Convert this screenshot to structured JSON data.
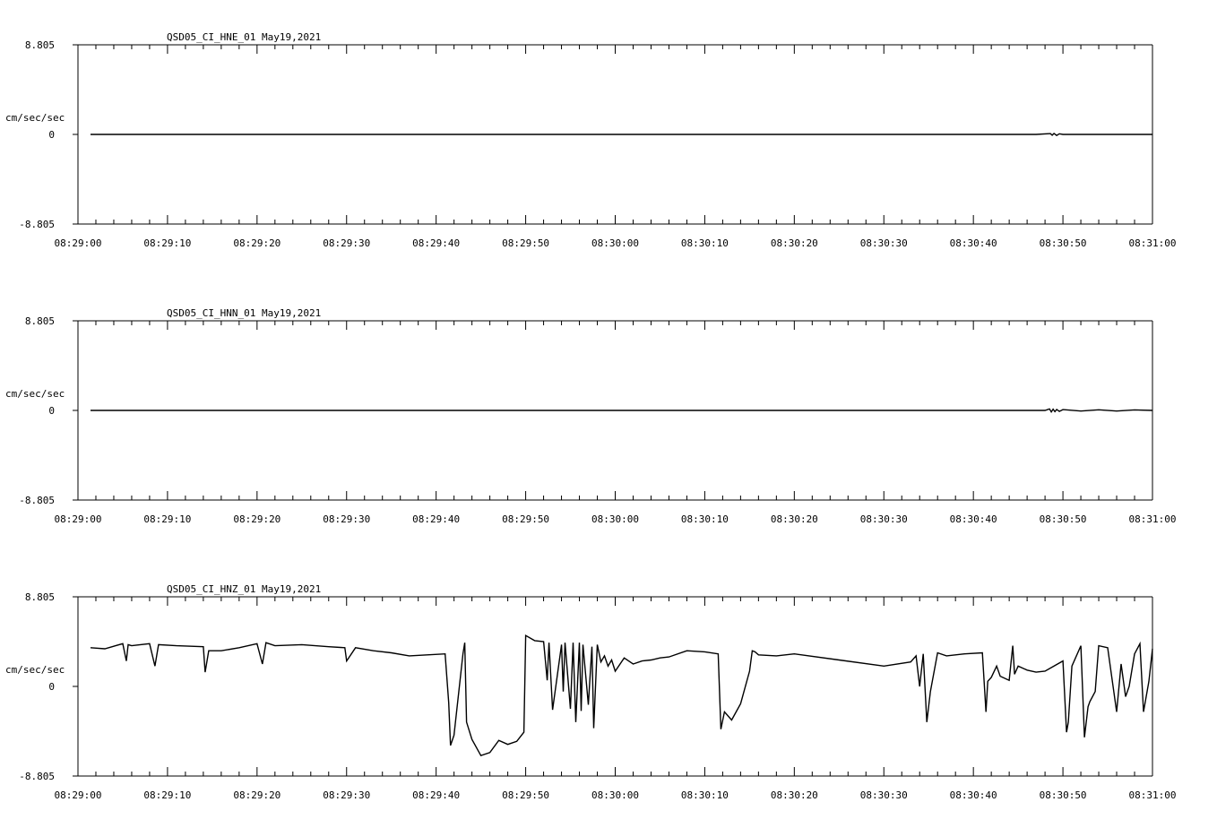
{
  "chart_data": [
    {
      "type": "line",
      "title": "QSD05_CI_HNE_01  May19,2021",
      "ylabel": "cm/sec/sec",
      "ylim": [
        -8.805,
        8.805
      ],
      "ytick_labels": [
        "8.805",
        "0",
        "-8.805"
      ],
      "x_ticks": [
        "08:29:00",
        "08:29:10",
        "08:29:20",
        "08:29:30",
        "08:29:40",
        "08:29:50",
        "08:30:00",
        "08:30:10",
        "08:30:20",
        "08:30:30",
        "08:30:40",
        "08:30:50",
        "08:31:00"
      ],
      "xlim_seconds": [
        0,
        120
      ],
      "series": [
        {
          "x": [
            1.4,
            40,
            80,
            107.0,
            108.6,
            108.8,
            109.0,
            109.3,
            109.6,
            110,
            115,
            120
          ],
          "y": [
            0,
            0,
            0,
            0,
            0.08,
            -0.08,
            0.1,
            -0.1,
            0.06,
            0,
            0,
            0
          ]
        }
      ]
    },
    {
      "type": "line",
      "title": "QSD05_CI_HNN_01  May19,2021",
      "ylabel": "cm/sec/sec",
      "ylim": [
        -8.805,
        8.805
      ],
      "ytick_labels": [
        "8.805",
        "0",
        "-8.805"
      ],
      "x_ticks": [
        "08:29:00",
        "08:29:10",
        "08:29:20",
        "08:29:30",
        "08:29:40",
        "08:29:50",
        "08:30:00",
        "08:30:10",
        "08:30:20",
        "08:30:30",
        "08:30:40",
        "08:30:50",
        "08:31:00"
      ],
      "xlim_seconds": [
        0,
        120
      ],
      "series": [
        {
          "x": [
            1.4,
            40,
            80,
            108.0,
            108.5,
            108.7,
            108.9,
            109.1,
            109.3,
            109.6,
            110.0,
            112,
            114,
            116,
            118,
            120
          ],
          "y": [
            0,
            0,
            0,
            0,
            0.15,
            -0.15,
            0.12,
            -0.12,
            0.1,
            -0.1,
            0.08,
            -0.06,
            0.06,
            -0.06,
            0.05,
            0
          ]
        }
      ]
    },
    {
      "type": "line",
      "title": "QSD05_CI_HNZ_01  May19,2021",
      "ylabel": "cm/sec/sec",
      "ylim": [
        -8.805,
        8.805
      ],
      "ytick_labels": [
        "8.805",
        "0",
        "-8.805"
      ],
      "x_ticks": [
        "08:29:00",
        "08:29:10",
        "08:29:20",
        "08:29:30",
        "08:29:40",
        "08:29:50",
        "08:30:00",
        "08:30:10",
        "08:30:20",
        "08:30:30",
        "08:30:40",
        "08:30:50",
        "08:31:00"
      ],
      "xlim_seconds": [
        0,
        120
      ],
      "series": [
        {
          "x": [
            1.4,
            3,
            5,
            5.4,
            5.6,
            6,
            8,
            8.6,
            9,
            11,
            14,
            14.2,
            14.6,
            16,
            18,
            20,
            20.6,
            21,
            22,
            25,
            28,
            29.8,
            30,
            31,
            33,
            35,
            37,
            39,
            41,
            41.4,
            41.6,
            42,
            43,
            43.2,
            43.4,
            44,
            45,
            46,
            47,
            48,
            49,
            49.8,
            50,
            51,
            52,
            52.4,
            52.6,
            53,
            54,
            54.2,
            54.4,
            55,
            55.3,
            55.6,
            56,
            56.2,
            56.4,
            57,
            57.4,
            57.6,
            58,
            58.4,
            58.8,
            59.2,
            59.6,
            60,
            61,
            62,
            63,
            64,
            65,
            66,
            68,
            70,
            71.5,
            71.8,
            72.2,
            73,
            74,
            75,
            75.3,
            75.6,
            76,
            78,
            80,
            85,
            90,
            93,
            93.6,
            94,
            94.4,
            94.8,
            95.2,
            96,
            97,
            99,
            101,
            101.4,
            101.6,
            102,
            102.6,
            103,
            104,
            104.4,
            104.6,
            105,
            106,
            107,
            108,
            110,
            110.4,
            110.6,
            111,
            112,
            112.4,
            112.8,
            113,
            113.6,
            114,
            115,
            116,
            116.5,
            117,
            117.4,
            118,
            118.6,
            119,
            119.6,
            120
          ],
          "y": [
            3.8,
            3.7,
            4.2,
            2.5,
            4.1,
            4.0,
            4.2,
            2.0,
            4.1,
            4.0,
            3.9,
            1.4,
            3.5,
            3.5,
            3.8,
            4.2,
            2.2,
            4.3,
            4.0,
            4.1,
            3.9,
            3.8,
            2.5,
            3.8,
            3.5,
            3.3,
            3.0,
            3.1,
            3.2,
            -1.6,
            -5.8,
            -4.8,
            3.2,
            4.3,
            -3.5,
            -5.2,
            -6.8,
            -6.5,
            -5.3,
            -5.7,
            -5.4,
            -4.5,
            5.0,
            4.5,
            4.4,
            0.6,
            4.3,
            -2.3,
            4.1,
            -0.5,
            4.3,
            -2.2,
            4.3,
            -3.5,
            4.3,
            -2.4,
            4.1,
            -1.8,
            3.9,
            -4.1,
            4.1,
            2.4,
            3.0,
            2.0,
            2.6,
            1.5,
            2.8,
            2.2,
            2.5,
            2.6,
            2.8,
            2.9,
            3.5,
            3.4,
            3.2,
            -4.2,
            -2.5,
            -3.3,
            -1.7,
            1.5,
            3.5,
            3.4,
            3.1,
            3.0,
            3.2,
            2.6,
            2.0,
            2.4,
            3.0,
            0.0,
            3.2,
            -3.5,
            -0.5,
            3.3,
            3.0,
            3.2,
            3.3,
            -2.5,
            0.5,
            0.9,
            2.0,
            1.0,
            0.6,
            4.0,
            1.2,
            2.0,
            1.6,
            1.4,
            1.5,
            2.5,
            -4.5,
            -3.5,
            2.0,
            4.0,
            -5.0,
            -2.0,
            -1.5,
            -0.5,
            4.0,
            3.8,
            -2.5,
            2.2,
            -1.0,
            0.0,
            3.2,
            4.2,
            -2.5,
            0.5,
            3.7
          ]
        }
      ]
    }
  ]
}
